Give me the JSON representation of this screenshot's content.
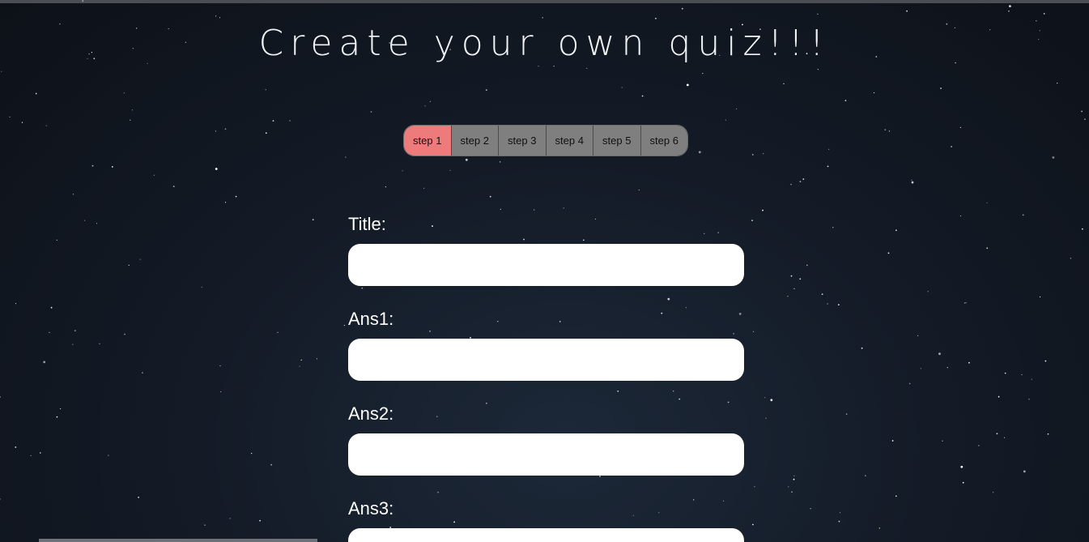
{
  "page": {
    "title": "Create your own quiz!!!"
  },
  "steps": [
    {
      "label": "step 1",
      "active": true
    },
    {
      "label": "step 2",
      "active": false
    },
    {
      "label": "step 3",
      "active": false
    },
    {
      "label": "step 4",
      "active": false
    },
    {
      "label": "step 5",
      "active": false
    },
    {
      "label": "step 6",
      "active": false
    }
  ],
  "form": {
    "fields": [
      {
        "label": "Title:",
        "value": ""
      },
      {
        "label": "Ans1:",
        "value": ""
      },
      {
        "label": "Ans2:",
        "value": ""
      },
      {
        "label": "Ans3:",
        "value": ""
      }
    ]
  },
  "colors": {
    "background": "#141b27",
    "step_active": "#ee7b7b",
    "step_inactive": "#7f7f7f",
    "title_text": "#f1f3f6"
  }
}
